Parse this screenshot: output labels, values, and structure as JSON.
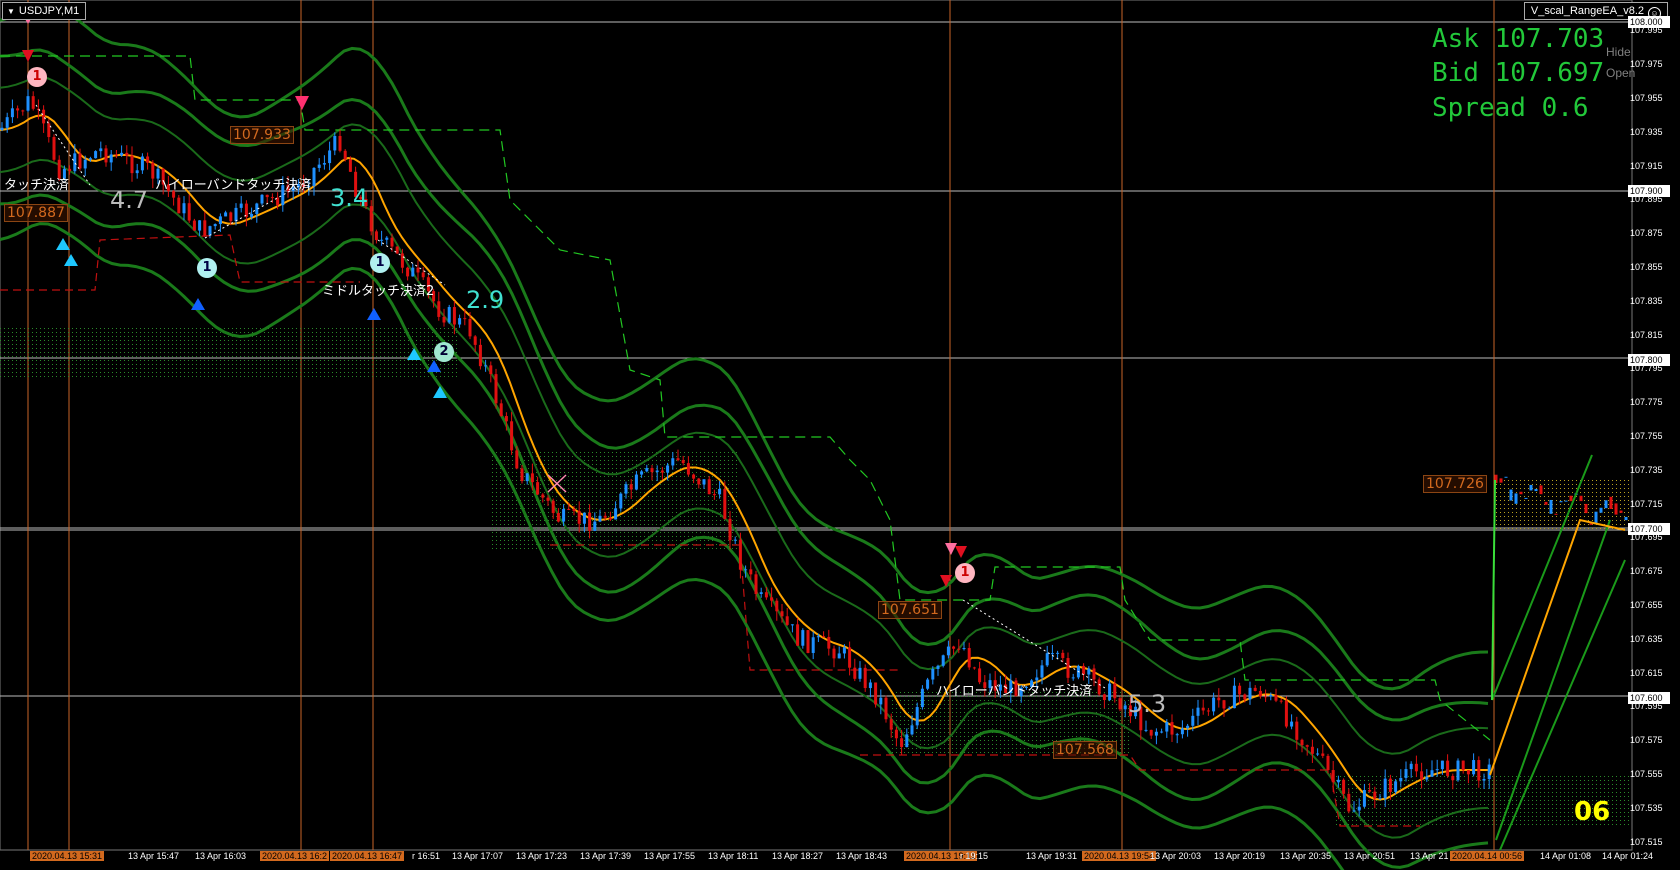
{
  "window": {
    "symbol_tab": "USDJPY,M1",
    "ea_name": "V_scal_RangeEA_v8.2"
  },
  "quote": {
    "ask": "Ask 107.703",
    "bid": "Bid 107.697",
    "spread": "Spread 0.6"
  },
  "side_buttons": {
    "hide": "Hide",
    "open": "Open"
  },
  "price_axis": {
    "ticks": [
      "107.995",
      "107.975",
      "107.955",
      "107.935",
      "107.915",
      "107.895",
      "107.875",
      "107.855",
      "107.835",
      "107.815",
      "107.795",
      "107.775",
      "107.755",
      "107.735",
      "107.715",
      "107.695",
      "107.675",
      "107.655",
      "107.635",
      "107.615",
      "107.595",
      "107.575",
      "107.555",
      "107.535",
      "107.515"
    ],
    "highlighted": [
      "108.000",
      "107.900",
      "107.800",
      "107.700",
      "107.600"
    ]
  },
  "time_axis": {
    "labels": [
      {
        "text": "2020.04.13 15:31",
        "hl": true
      },
      {
        "text": "13 Apr 15:47",
        "hl": false
      },
      {
        "text": "13 Apr 16:03",
        "hl": false
      },
      {
        "text": "2020.04.13 16:2",
        "hl": true
      },
      {
        "text": "2020.04.13 16:47",
        "hl": true
      },
      {
        "text": "r 16:51",
        "hl": false
      },
      {
        "text": "13 Apr 17:07",
        "hl": false
      },
      {
        "text": "13 Apr 17:23",
        "hl": false
      },
      {
        "text": "13 Apr 17:39",
        "hl": false
      },
      {
        "text": "13 Apr 17:55",
        "hl": false
      },
      {
        "text": "13 Apr 18:11",
        "hl": false
      },
      {
        "text": "13 Apr 18:27",
        "hl": false
      },
      {
        "text": "13 Apr 18:43",
        "hl": false
      },
      {
        "text": "2020.04.13 19:11",
        "hl": true
      },
      {
        "text": "r 19:15",
        "hl": false
      },
      {
        "text": "13 Apr 19:31",
        "hl": false
      },
      {
        "text": "2020.04.13 19:54",
        "hl": true
      },
      {
        "text": "13 Apr 20:03",
        "hl": false
      },
      {
        "text": "13 Apr 20:19",
        "hl": false
      },
      {
        "text": "13 Apr 20:35",
        "hl": false
      },
      {
        "text": "13 Apr 20:51",
        "hl": false
      },
      {
        "text": "13 Apr 21",
        "hl": false
      },
      {
        "text": "2020.04.14 00:56",
        "hl": true
      },
      {
        "text": "14 Apr 01:08",
        "hl": false
      },
      {
        "text": "14 Apr 01:24",
        "hl": false
      }
    ]
  },
  "annotations": {
    "jp_labels": [
      "タッチ決済",
      "ハイローバンドタッチ決済",
      "ミドルタッチ決済2",
      "ハイローバンドタッチ決済"
    ],
    "price_boxes": [
      "107.933",
      "107.887",
      "107.651",
      "107.568",
      "107.726"
    ],
    "big_numbers": [
      "4.7",
      "3.4",
      "2.9",
      "5.3"
    ],
    "corner_number": "06",
    "mark_numbers": [
      "1",
      "1",
      "1",
      "2",
      "1"
    ]
  },
  "colors": {
    "background": "#000000",
    "band_green": "#1a7a1a",
    "ma_orange": "#ffa500",
    "bull_candle": "#1e90ff",
    "bear_candle": "#e01010",
    "quote_green": "#22c83a",
    "vline": "#c86428"
  }
}
